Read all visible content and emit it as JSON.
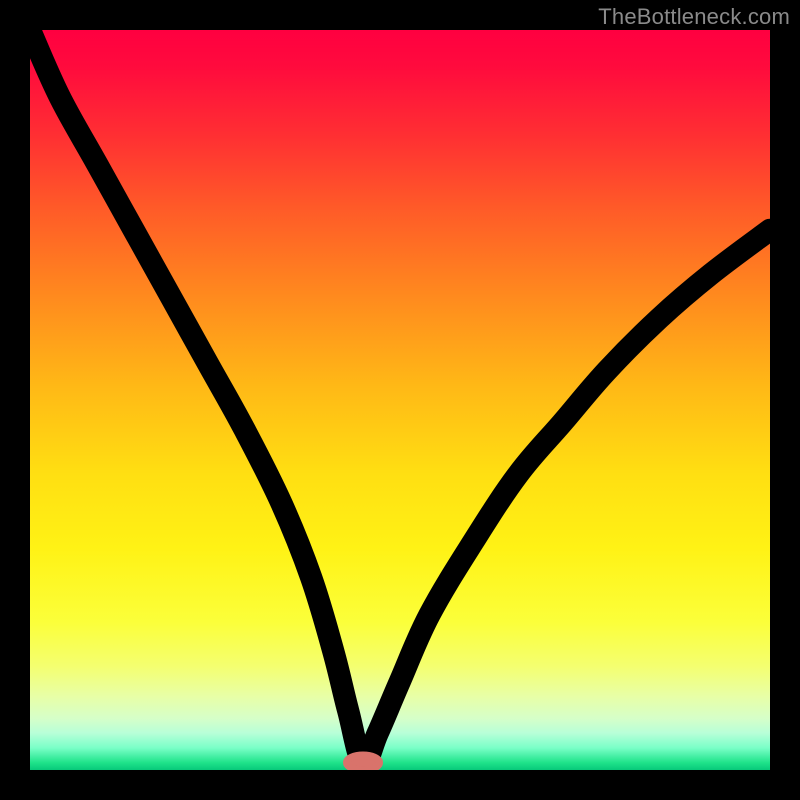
{
  "watermark": "TheBottleneck.com",
  "colors": {
    "frame": "#000000",
    "gradient_top": "#ff0040",
    "gradient_bottom": "#07c97a",
    "curve": "#000000",
    "marker": "#d9736b",
    "watermark": "#8a8a8a"
  },
  "chart_data": {
    "type": "line",
    "title": "",
    "xlabel": "",
    "ylabel": "",
    "xlim": [
      0,
      100
    ],
    "ylim": [
      0,
      100
    ],
    "notes": "V-shaped bottleneck curve on vertical red→green gradient. Minimum (optimal) marked by salmon oval at x≈45, y≈1.",
    "series": [
      {
        "name": "bottleneck-curve",
        "x": [
          0,
          4,
          9,
          14,
          19,
          24,
          29,
          34,
          38,
          41,
          43,
          45,
          47,
          50,
          54,
          60,
          66,
          72,
          78,
          85,
          92,
          100
        ],
        "y": [
          100,
          91,
          82,
          73,
          64,
          55,
          46,
          36,
          26,
          16,
          8,
          1,
          5,
          12,
          21,
          31,
          40,
          47,
          54,
          61,
          67,
          73
        ]
      }
    ],
    "marker": {
      "x": 45,
      "y": 1,
      "rx": 2.2,
      "ry": 1.0
    }
  }
}
